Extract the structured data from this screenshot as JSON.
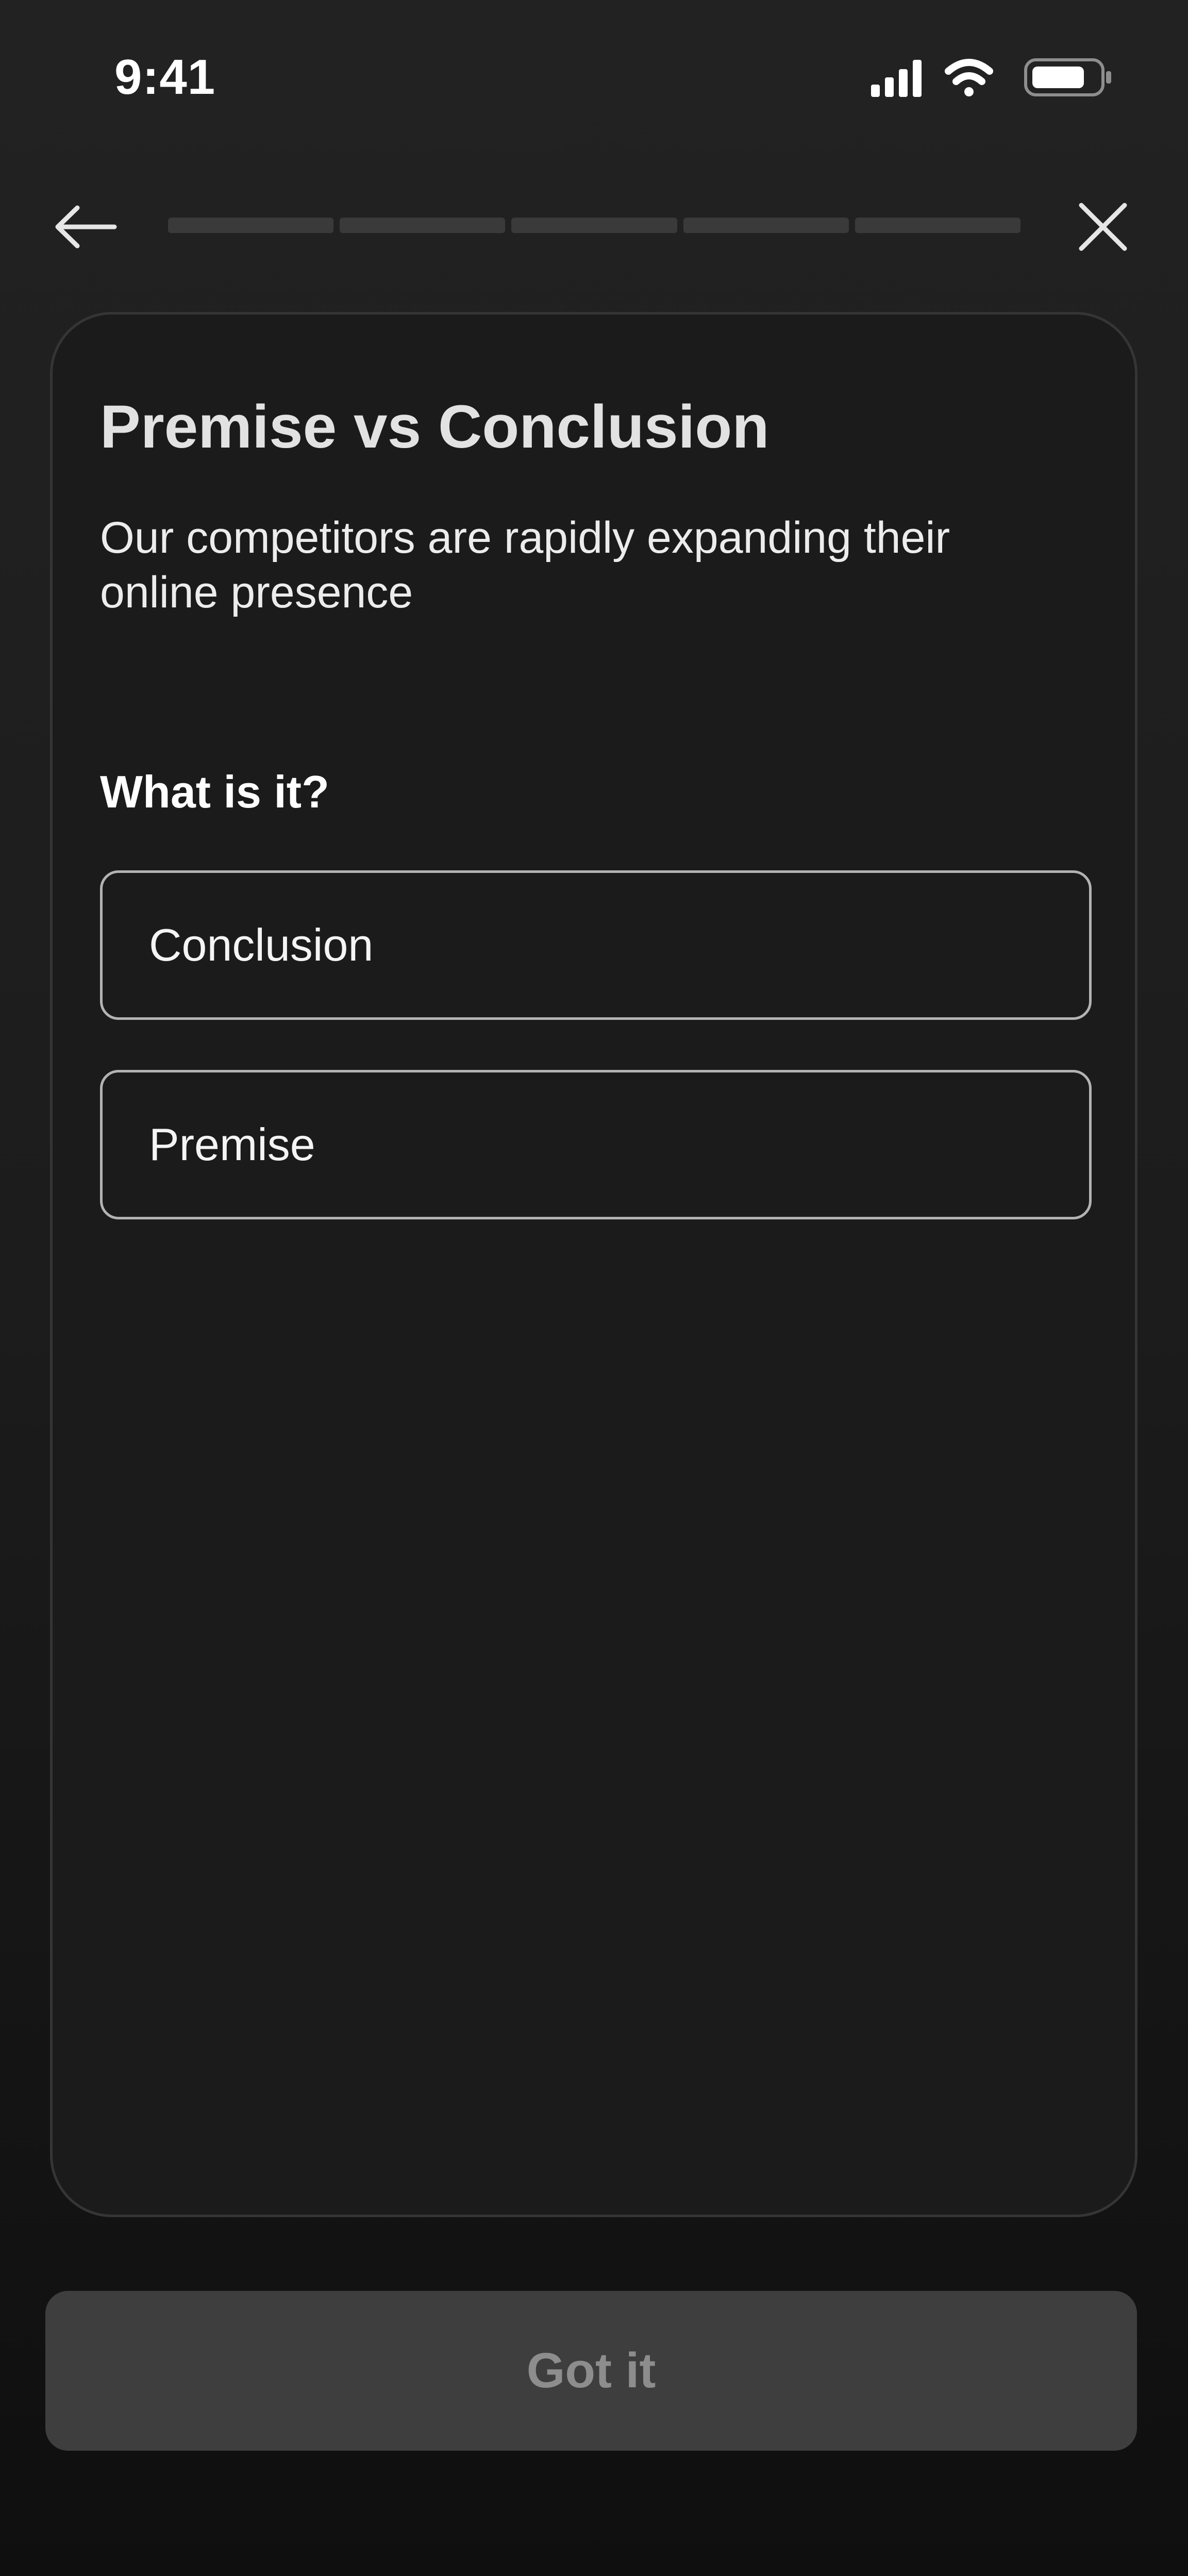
{
  "status_bar": {
    "time": "9:41",
    "icons": [
      "cellular-signal-icon",
      "wifi-icon",
      "battery-icon"
    ]
  },
  "nav": {
    "back_icon": "arrow-left-icon",
    "close_icon": "close-icon",
    "progress_segments": 5,
    "progress_completed": 0
  },
  "card": {
    "title": "Premise vs Conclusion",
    "statement": "Our competitors are rapidly expanding their online presence",
    "question": "What is it?",
    "options": [
      {
        "label": "Conclusion"
      },
      {
        "label": "Premise"
      }
    ]
  },
  "footer": {
    "button_label": "Got it"
  },
  "colors": {
    "background_top": "#222222",
    "background_bottom": "#0f0f0f",
    "card_background": "#1b1b1b",
    "card_border": "#353535",
    "option_border": "#b3b3b3",
    "progress_track": "#3a3a3a",
    "button_disabled_bg": "#3e3e3e",
    "button_disabled_text": "#8d8d8d"
  }
}
